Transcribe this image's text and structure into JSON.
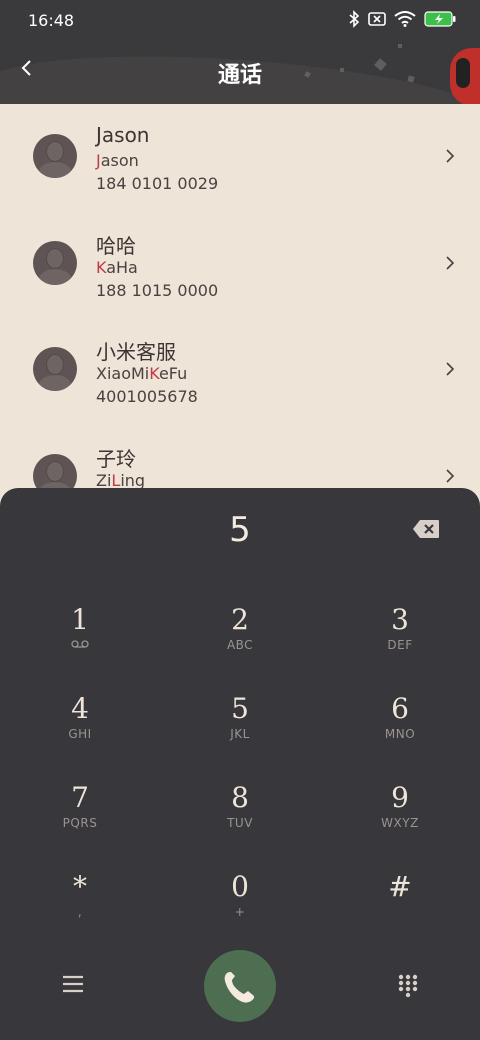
{
  "status_bar": {
    "time": "16:48"
  },
  "header": {
    "title": "通话"
  },
  "contacts": [
    {
      "name": "Jason",
      "pinyin_hl": "J",
      "pinyin_pre": "",
      "pinyin_rest": "ason",
      "number": "184 0101 0029"
    },
    {
      "name": "哈哈",
      "pinyin_hl": "K",
      "pinyin_pre": "",
      "pinyin_rest": "aHa",
      "number": "188 1015 0000"
    },
    {
      "name": "小米客服",
      "pinyin_pre": "XiaoMi",
      "pinyin_hl": "K",
      "pinyin_rest": "eFu",
      "number": "4001005678"
    },
    {
      "name": "子玲",
      "pinyin_pre": "Zi",
      "pinyin_hl": "L",
      "pinyin_rest": "ing",
      "number": ""
    }
  ],
  "dialpad": {
    "entered": "5",
    "keys": [
      {
        "digit": "1",
        "letters": ""
      },
      {
        "digit": "2",
        "letters": "ABC"
      },
      {
        "digit": "3",
        "letters": "DEF"
      },
      {
        "digit": "4",
        "letters": "GHI"
      },
      {
        "digit": "5",
        "letters": "JKL"
      },
      {
        "digit": "6",
        "letters": "MNO"
      },
      {
        "digit": "7",
        "letters": "PQRS"
      },
      {
        "digit": "8",
        "letters": "TUV"
      },
      {
        "digit": "9",
        "letters": "WXYZ"
      },
      {
        "digit": "*",
        "letters": ","
      },
      {
        "digit": "0",
        "letters": "+"
      },
      {
        "digit": "#",
        "letters": ""
      }
    ]
  },
  "colors": {
    "accent_highlight": "#c1394a",
    "call_button": "#4e6e52",
    "dialpad_bg": "#38373b",
    "list_bg": "#efe4d8"
  },
  "icons": [
    "bluetooth-icon",
    "sim-icon",
    "wifi-icon",
    "battery-charging-icon",
    "back-icon",
    "chevron-right-icon",
    "backspace-icon",
    "voicemail-icon",
    "menu-icon",
    "phone-icon",
    "dialpad-grid-icon"
  ]
}
